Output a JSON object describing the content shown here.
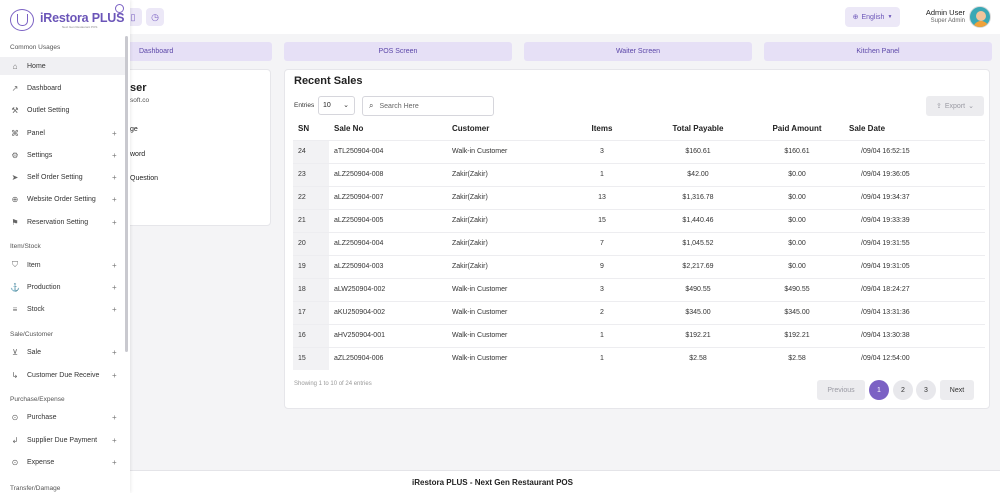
{
  "brand": {
    "name": "iRestora PLUS",
    "tagline": "Next Gen Restaurant POS"
  },
  "header": {
    "language": "English",
    "user_name": "Admin User",
    "user_role": "Super Admin"
  },
  "shortcuts": [
    {
      "label": "Dashboard"
    },
    {
      "label": "POS Screen"
    },
    {
      "label": "Waiter Screen"
    },
    {
      "label": "Kitchen Panel"
    }
  ],
  "profile_card": {
    "name_fragment": "ser",
    "email_fragment": "soft.co",
    "links": [
      "ge",
      "word",
      "Question"
    ]
  },
  "sidebar": {
    "sections": [
      {
        "title": "Common Usages"
      },
      {
        "title": "Item/Stock"
      },
      {
        "title": "Sale/Customer"
      },
      {
        "title": "Purchase/Expense"
      },
      {
        "title": "Transfer/Damage"
      }
    ],
    "items": [
      {
        "label": "Home",
        "icon": "home-icon",
        "expand": ""
      },
      {
        "label": "Dashboard",
        "icon": "bar-chart-icon",
        "expand": ""
      },
      {
        "label": "Outlet Setting",
        "icon": "wrench-icon",
        "expand": ""
      },
      {
        "label": "Panel",
        "icon": "command-icon",
        "expand": "+"
      },
      {
        "label": "Settings",
        "icon": "gear-icon",
        "expand": "+"
      },
      {
        "label": "Self Order Setting",
        "icon": "send-icon",
        "expand": "+"
      },
      {
        "label": "Website Order Setting",
        "icon": "globe-icon",
        "expand": "+"
      },
      {
        "label": "Reservation Setting",
        "icon": "bookmark-icon",
        "expand": "+"
      },
      {
        "label": "Item",
        "icon": "shield-icon",
        "expand": "+"
      },
      {
        "label": "Production",
        "icon": "anchor-icon",
        "expand": "+"
      },
      {
        "label": "Stock",
        "icon": "layers-icon",
        "expand": "+"
      },
      {
        "label": "Sale",
        "icon": "cart-icon",
        "expand": "+"
      },
      {
        "label": "Customer Due Receive",
        "icon": "corner-arrow-icon",
        "expand": "+"
      },
      {
        "label": "Purchase",
        "icon": "arrow-down-circle-icon",
        "expand": "+"
      },
      {
        "label": "Supplier Due Payment",
        "icon": "corner-left-icon",
        "expand": "+"
      },
      {
        "label": "Expense",
        "icon": "arrow-right-circle-icon",
        "expand": "+"
      }
    ]
  },
  "recent_sales": {
    "title": "Recent Sales",
    "entries_label": "Entries",
    "entries_value": "10",
    "search_placeholder": "Search Here",
    "export_label": "Export",
    "columns": [
      "SN",
      "Sale No",
      "Customer",
      "Items",
      "Total Payable",
      "Paid Amount",
      "Sale Date"
    ],
    "rows": [
      [
        "24",
        "aTL250904-004",
        "Walk-in Customer",
        "3",
        "$160.61",
        "$160.61",
        "/09/04 16:52:15"
      ],
      [
        "23",
        "aLZ250904-008",
        "Zakir(Zakir)",
        "1",
        "$42.00",
        "$0.00",
        "/09/04 19:36:05"
      ],
      [
        "22",
        "aLZ250904-007",
        "Zakir(Zakir)",
        "13",
        "$1,316.78",
        "$0.00",
        "/09/04 19:34:37"
      ],
      [
        "21",
        "aLZ250904-005",
        "Zakir(Zakir)",
        "15",
        "$1,440.46",
        "$0.00",
        "/09/04 19:33:39"
      ],
      [
        "20",
        "aLZ250904-004",
        "Zakir(Zakir)",
        "7",
        "$1,045.52",
        "$0.00",
        "/09/04 19:31:55"
      ],
      [
        "19",
        "aLZ250904-003",
        "Zakir(Zakir)",
        "9",
        "$2,217.69",
        "$0.00",
        "/09/04 19:31:05"
      ],
      [
        "18",
        "aLW250904-002",
        "Walk-in Customer",
        "3",
        "$490.55",
        "$490.55",
        "/09/04 18:24:27"
      ],
      [
        "17",
        "aKU250904-002",
        "Walk-in Customer",
        "2",
        "$345.00",
        "$345.00",
        "/09/04 13:31:36"
      ],
      [
        "16",
        "aHV250904-001",
        "Walk-in Customer",
        "1",
        "$192.21",
        "$192.21",
        "/09/04 13:30:38"
      ],
      [
        "15",
        "aZL250904-006",
        "Walk-in Customer",
        "1",
        "$2.58",
        "$2.58",
        "/09/04 12:54:00"
      ]
    ],
    "showing_text": "Showing 1 to 10 of 24 entries",
    "pagination": {
      "previous": "Previous",
      "pages": [
        "1",
        "2",
        "3"
      ],
      "next": "Next",
      "current": "1"
    }
  },
  "footer": {
    "text": "iRestora PLUS - Next Gen Restaurant POS"
  },
  "colors": {
    "accent": "#7b61c4",
    "accent_light": "#e6e0f6",
    "background": "#f4f4f6"
  }
}
